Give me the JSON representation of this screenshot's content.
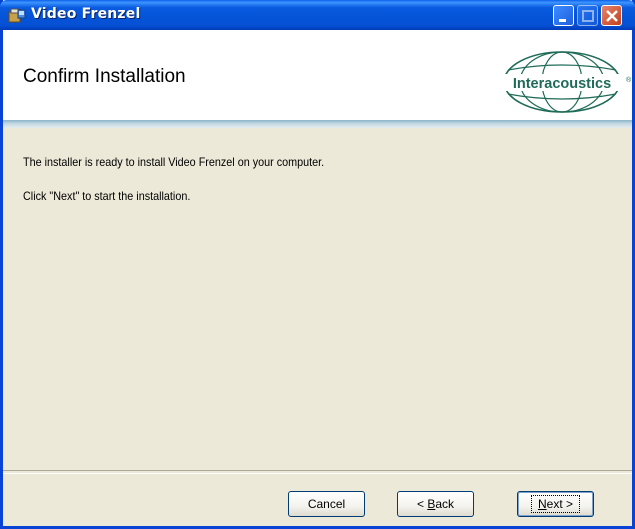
{
  "window": {
    "title": "Video Frenzel",
    "title_buttons": [
      "minimize-button",
      "maximize-button",
      "close-button"
    ]
  },
  "banner": {
    "title": "Confirm Installation",
    "logo_text": "Interacoustics",
    "logo_registered": "®"
  },
  "content": {
    "line1": "The installer is ready to install Video Frenzel on your computer.",
    "line2": "Click \"Next\" to start the installation."
  },
  "buttons": {
    "cancel": "Cancel",
    "back_prefix": "< ",
    "back_accel": "B",
    "back_rest": "ack",
    "next_accel": "N",
    "next_rest": "ext >"
  },
  "colors": {
    "titlebar": "#0554d8",
    "dialog_bg": "#ece9d8",
    "logo_green": "#1f6b57"
  },
  "icons": {
    "app": "installer-package-icon",
    "minimize": "minimize-icon",
    "maximize": "maximize-icon",
    "close": "close-icon"
  }
}
